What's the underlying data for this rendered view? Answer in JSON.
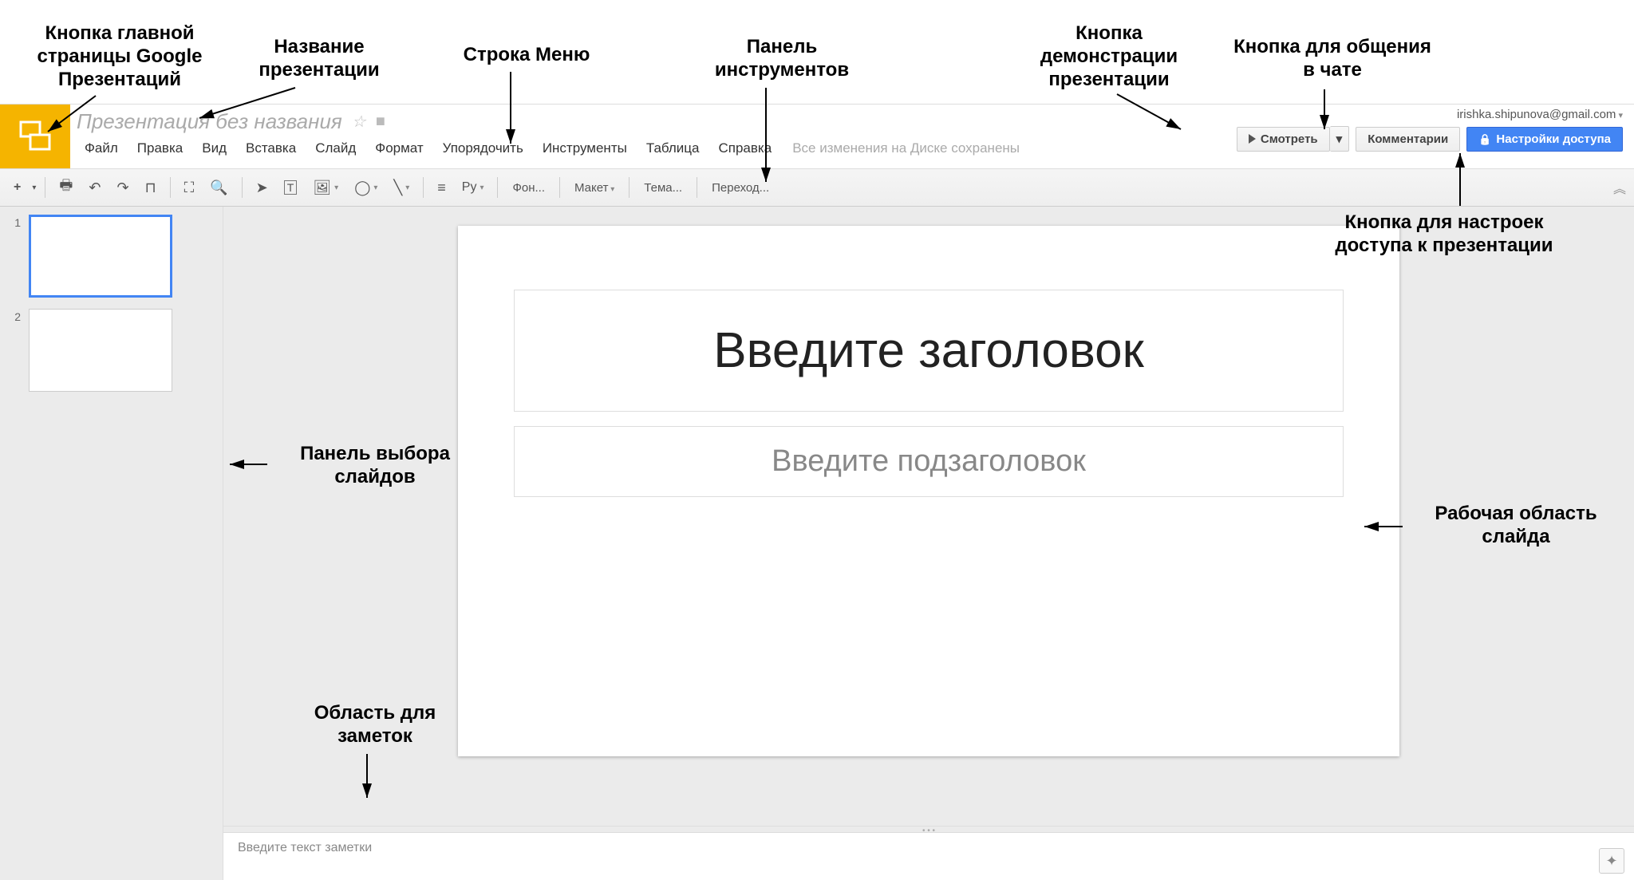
{
  "annotations": {
    "logo": "Кнопка главной страницы Google Презентаций",
    "title": "Название презентации",
    "menubar": "Строка Меню",
    "toolbar": "Панель инструментов",
    "present": "Кнопка демонстрации презентации",
    "chat": "Кнопка для общения в чате",
    "share": "Кнопка для настроек доступа к презентации",
    "filmstrip": "Панель выбора слайдов",
    "canvas": "Рабочая область слайда",
    "notes": "Область для заметок"
  },
  "header": {
    "doc_title": "Презентация без названия",
    "user_email": "irishka.shipunova@gmail.com",
    "present_btn": "Смотреть",
    "comments_btn": "Комментарии",
    "share_btn": "Настройки доступа",
    "save_status": "Все изменения на Диске сохранены"
  },
  "menu": {
    "file": "Файл",
    "edit": "Правка",
    "view": "Вид",
    "insert": "Вставка",
    "slide": "Слайд",
    "format": "Формат",
    "arrange": "Упорядочить",
    "tools": "Инструменты",
    "table": "Таблица",
    "help": "Справка"
  },
  "toolbar": {
    "background": "Фон...",
    "layout": "Макет",
    "theme": "Тема...",
    "transition": "Переход...",
    "paint": "Ру"
  },
  "slides": {
    "n1": "1",
    "n2": "2"
  },
  "slide": {
    "title_placeholder": "Введите заголовок",
    "subtitle_placeholder": "Введите подзаголовок"
  },
  "notes": {
    "placeholder": "Введите текст заметки"
  }
}
